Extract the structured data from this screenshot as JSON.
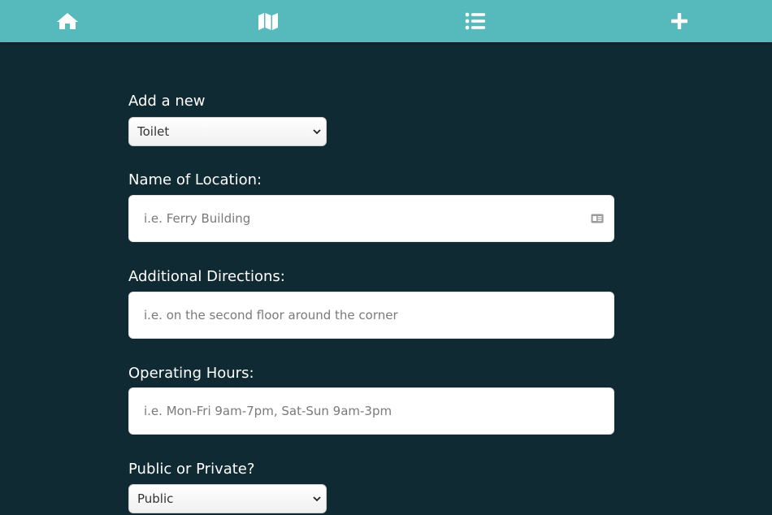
{
  "nav": {
    "items": [
      {
        "icon": "home-icon"
      },
      {
        "icon": "map-icon"
      },
      {
        "icon": "list-icon"
      },
      {
        "icon": "plus-icon"
      }
    ]
  },
  "colors": {
    "navbar": "#56b9bb",
    "background": "#0f2a33",
    "text": "#ffffff"
  },
  "form": {
    "type_label": "Add a new",
    "type_value": "Toilet",
    "name_label": "Name of Location:",
    "name_placeholder": "i.e. Ferry Building",
    "directions_label": "Additional Directions:",
    "directions_placeholder": "i.e. on the second floor around the corner",
    "hours_label": "Operating Hours:",
    "hours_placeholder": "i.e. Mon-Fri 9am-7pm, Sat-Sun 9am-3pm",
    "access_label": "Public or Private?",
    "access_value": "Public"
  }
}
